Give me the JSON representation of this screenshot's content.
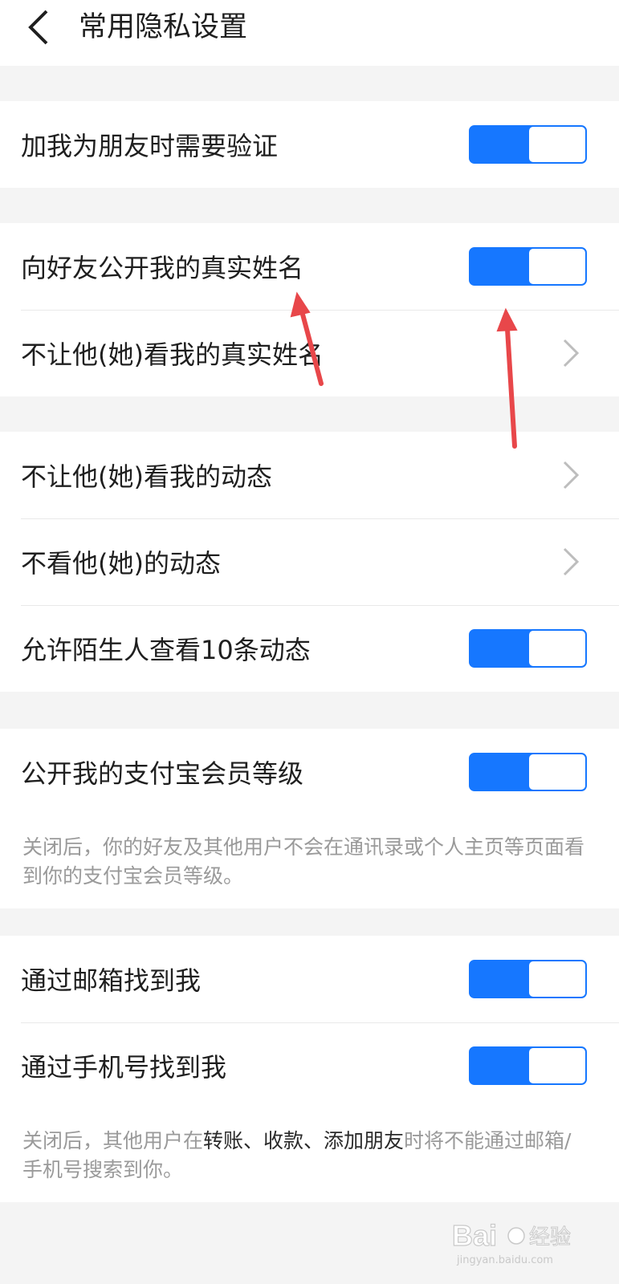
{
  "header": {
    "title": "常用隐私设置",
    "back_icon": "chevron-left-icon"
  },
  "groups": [
    {
      "rows": [
        {
          "label": "加我为朋友时需要验证",
          "type": "toggle",
          "on": true
        }
      ]
    },
    {
      "rows": [
        {
          "label": "向好友公开我的真实姓名",
          "type": "toggle",
          "on": true
        },
        {
          "label": "不让他(她)看我的真实姓名",
          "type": "chevron",
          "icon": "chevron-right-icon"
        }
      ]
    },
    {
      "rows": [
        {
          "label": "不让他(她)看我的动态",
          "type": "chevron",
          "icon": "chevron-right-icon"
        },
        {
          "label": "不看他(她)的动态",
          "type": "chevron",
          "icon": "chevron-right-icon"
        },
        {
          "label": "允许陌生人查看10条动态",
          "type": "toggle",
          "on": true
        }
      ]
    },
    {
      "rows": [
        {
          "label": "公开我的支付宝会员等级",
          "type": "toggle",
          "on": true
        }
      ],
      "note": {
        "text": "关闭后，你的好友及其他用户不会在通讯录或个人主页等页面看到你的支付宝会员等级。"
      }
    },
    {
      "rows": [
        {
          "label": "通过邮箱找到我",
          "type": "toggle",
          "on": true
        },
        {
          "label": "通过手机号找到我",
          "type": "toggle",
          "on": true
        }
      ],
      "note": {
        "part1": "关闭后，其他用户在",
        "highlight": "转账、收款、添加朋友",
        "part2": "时将不能通过邮箱/手机号搜索到你。"
      }
    }
  ],
  "colors": {
    "accent": "#1677ff",
    "background": "#f4f4f4",
    "annotation_arrow": "#e8474a"
  },
  "watermark": {
    "text": "Bai 经验",
    "sub": "jingyan.baidu.com"
  }
}
